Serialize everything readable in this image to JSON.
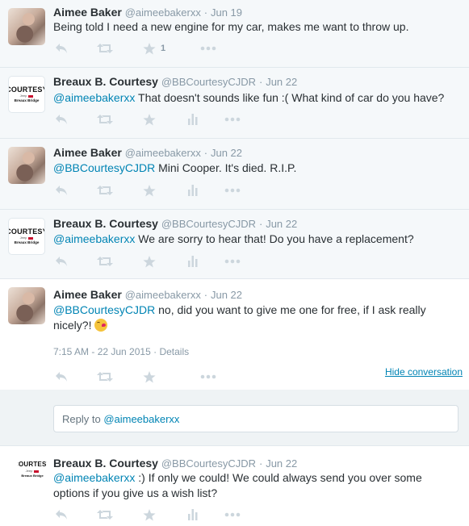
{
  "tweets": [
    {
      "name": "Aimee Baker",
      "handle": "@aimeebakerxx",
      "date": "Jun 19",
      "mention": "",
      "text": "Being told I need a new engine for my car, makes me want to throw up.",
      "favorite_count": "1"
    },
    {
      "name": "Breaux B. Courtesy",
      "handle": "@BBCourtesyCJDR",
      "date": "Jun 22",
      "mention": "@aimeebakerxx",
      "text": " That doesn't sounds like fun :( What kind of car do you have?"
    },
    {
      "name": "Aimee Baker",
      "handle": "@aimeebakerxx",
      "date": "Jun 22",
      "mention": "@BBCourtesyCJDR",
      "text": " Mini Cooper. It's died. R.I.P."
    },
    {
      "name": "Breaux B. Courtesy",
      "handle": "@BBCourtesyCJDR",
      "date": "Jun 22",
      "mention": "@aimeebakerxx",
      "text": " We are sorry to hear that! Do you have a replacement?"
    },
    {
      "name": "Aimee Baker",
      "handle": "@aimeebakerxx",
      "date": "Jun 22",
      "mention": "@BBCourtesyCJDR",
      "text": " no, did you want to give me one for free, if I ask really nicely?! ",
      "emoji": "kiss-wink-emoji",
      "timestamp": "7:15 AM - 22 Jun 2015",
      "details_label": "Details",
      "hide_conversation_label": "Hide conversation"
    },
    {
      "name": "Breaux B. Courtesy",
      "handle": "@BBCourtesyCJDR",
      "date": "Jun 22",
      "mention": "@aimeebakerxx",
      "text": " :) If only we could! We could always send you over some options if you give us a wish list?"
    }
  ],
  "reply": {
    "placeholder": "Reply to ",
    "mention": "@aimeebakerxx"
  },
  "logo": {
    "main": "COURTESY",
    "brands": "Jeep",
    "sub": "Breaux Bridge"
  },
  "separator": "·",
  "icons": [
    "reply-icon",
    "retweet-icon",
    "favorite-star-icon",
    "analytics-icon",
    "more-dots-icon"
  ],
  "colors": {
    "link": "#0084b4",
    "muted": "#8899a6",
    "icon": "#ccd6dd",
    "text": "#292f33"
  }
}
